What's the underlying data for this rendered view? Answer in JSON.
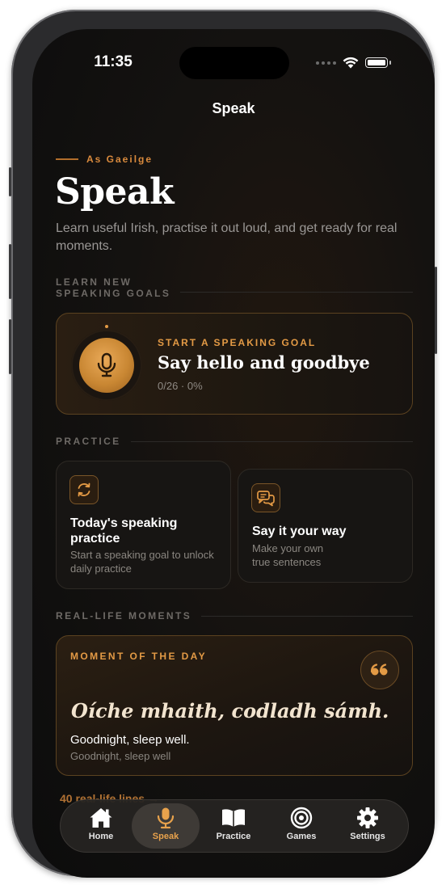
{
  "status_bar": {
    "time": "11:35"
  },
  "nav": {
    "title": "Speak"
  },
  "header": {
    "eyebrow": "As Gaeilge",
    "title": "Speak",
    "subtitle": "Learn useful Irish, practise it out loud, and get ready for real moments."
  },
  "sections": {
    "learn": "LEARN NEW\nSPEAKING GOALS",
    "practice": "PRACTICE",
    "moments": "REAL-LIFE MOMENTS"
  },
  "goal_card": {
    "kicker": "START A SPEAKING GOAL",
    "title": "Say hello and goodbye",
    "progress": "0/26 · 0%",
    "icon": "microphone-icon"
  },
  "practice_cards": [
    {
      "title": "Today's speaking practice",
      "subtitle": "Start a speaking goal to unlock daily practice",
      "icon": "refresh-icon"
    },
    {
      "title": "Say it your way",
      "subtitle": "Make your own true sentences",
      "icon": "speech-bubbles-icon"
    }
  ],
  "moment": {
    "kicker": "MOMENT OF THE DAY",
    "phrase": "Oíche mhaith, codladh sámh.",
    "translation": "Goodnight, sleep well.",
    "literal": "Goodnight, sleep well",
    "icon": "quote-icon"
  },
  "more_link": "40 real-life lines →",
  "tabs": [
    {
      "label": "Home",
      "icon": "home-icon"
    },
    {
      "label": "Speak",
      "icon": "microphone-icon",
      "active": true
    },
    {
      "label": "Practice",
      "icon": "book-icon"
    },
    {
      "label": "Games",
      "icon": "target-icon"
    },
    {
      "label": "Settings",
      "icon": "gear-icon"
    }
  ],
  "colors": {
    "accent": "#e39a45",
    "background": "#141210",
    "card_border": "#5b4220"
  }
}
